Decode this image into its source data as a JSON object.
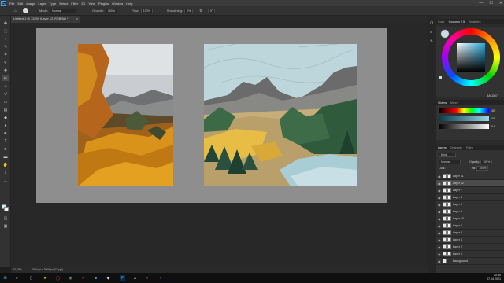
{
  "app": {
    "name": "Ps"
  },
  "menu": [
    "File",
    "Edit",
    "Image",
    "Layer",
    "Type",
    "Select",
    "Filter",
    "3D",
    "View",
    "Plugins",
    "Window",
    "Help"
  ],
  "window_controls": [
    "—",
    "☐",
    "✕"
  ],
  "options": {
    "mode_label": "Mode:",
    "mode_value": "Normal",
    "opacity_label": "Opacity:",
    "opacity_value": "100%",
    "flow_label": "Flow:",
    "flow_value": "100%",
    "smoothing_label": "Smoothing:",
    "smoothing_value": "0%",
    "angle_value": "0°"
  },
  "document_tab": {
    "title": "Untitled-1 @ 33,3% (Layer 12, RGB/8#) *",
    "close": "×"
  },
  "status": {
    "zoom": "33,33%",
    "doc_size": "4000 px x 2000 px (72 ppi)"
  },
  "panels": {
    "color_tabs": [
      "Color",
      "Coolorus 2.5",
      "Swatches"
    ],
    "hex_value": "BACDD7",
    "sliders_tabs": [
      "Sliders",
      "Mixer"
    ],
    "slider_values": [
      "185",
      "205",
      "215"
    ],
    "layers_tabs": [
      "Layers",
      "Channels",
      "Paths"
    ],
    "blend_mode": "Normal",
    "opacity_label": "Opacity:",
    "opacity_value": "100%",
    "fill_label": "Fill:",
    "fill_value": "100%",
    "kind_label": "Kind",
    "lock_label": "Lock:",
    "layers": [
      {
        "name": "Layer 11",
        "selected": false
      },
      {
        "name": "Layer 12",
        "selected": true
      },
      {
        "name": "Layer 7",
        "selected": false
      },
      {
        "name": "Layer 8",
        "selected": false
      },
      {
        "name": "Layer 9",
        "selected": false
      },
      {
        "name": "Layer 5",
        "selected": false
      },
      {
        "name": "Layer 10",
        "selected": false
      },
      {
        "name": "Layer 6",
        "selected": false
      },
      {
        "name": "Layer 3",
        "selected": false
      },
      {
        "name": "Layer 4",
        "selected": false
      },
      {
        "name": "Layer 2",
        "selected": false
      },
      {
        "name": "Layer 1",
        "selected": false
      },
      {
        "name": "Background",
        "selected": false
      }
    ]
  },
  "taskbar": {
    "time": "20:30",
    "date": "07.04.2021"
  },
  "colors": {
    "accent": "#31a8ff",
    "foreground_color": "#c9dde3"
  }
}
